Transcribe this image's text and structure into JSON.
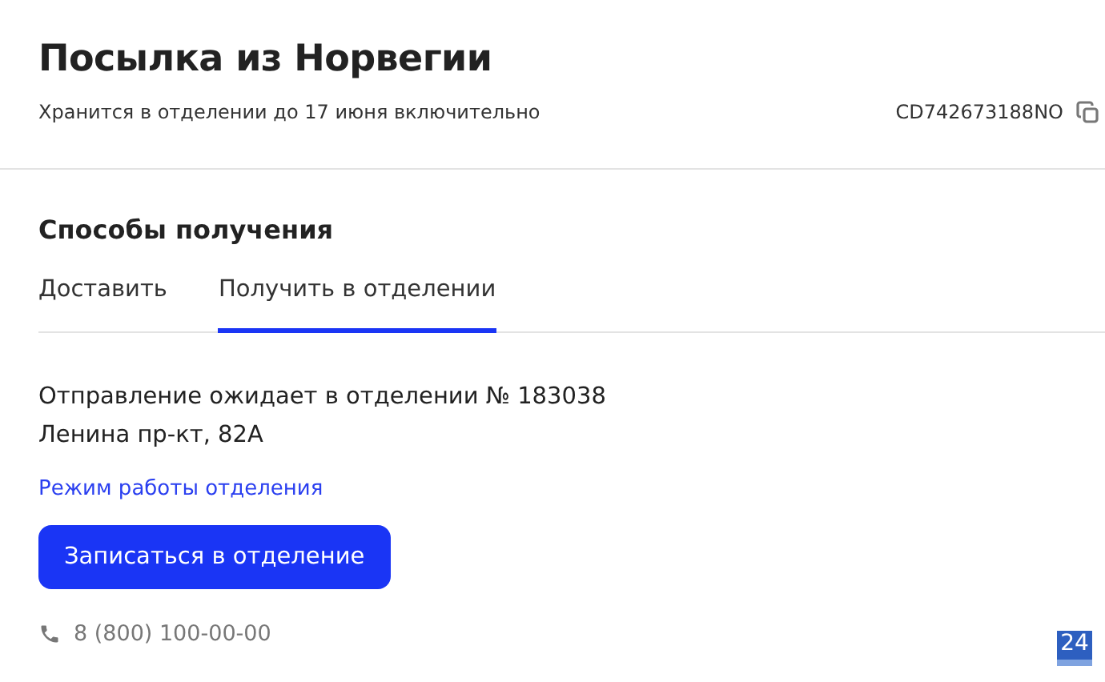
{
  "header": {
    "title": "Посылка из Норвегии",
    "subtitle": "Хранится в отделении до 17 июня включительно",
    "tracking_number": "CD742673188NO"
  },
  "section": {
    "title": "Способы получения",
    "tabs": [
      {
        "label": "Доставить",
        "selected": false
      },
      {
        "label": "Получить в отделении",
        "selected": true
      }
    ],
    "message_lines": [
      "Отправление ожидает в отделении № 183038",
      "Ленина пр-кт, 82А"
    ],
    "hours_link": "Режим работы отделения",
    "button": "Записаться в отделение",
    "phone": "8 (800) 100-00-00"
  },
  "badge": "24"
}
